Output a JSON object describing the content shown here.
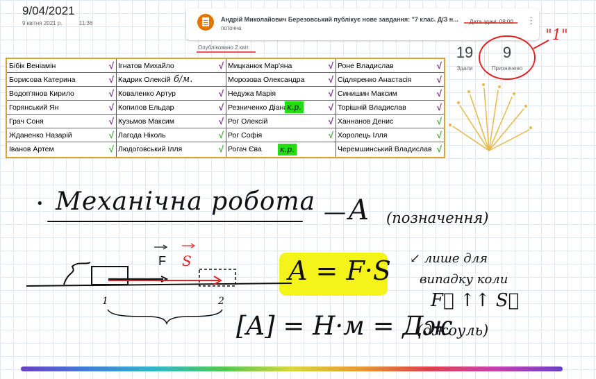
{
  "note": {
    "date": "9/04/2021",
    "subdate": "9 квітня 2021 р.",
    "subtime": "11:36"
  },
  "classroom": {
    "title": "Андрій Миколайович Березовський публікує нове завдання: \"7 клас. Д/З н...",
    "subtitle": "поточна",
    "due": "Дата здачі: 08:00",
    "published": "Опубліковано 2 квіт.",
    "assigned_count": "19",
    "assigned_label": "Здали",
    "done_count": "9",
    "done_label": "Призначено"
  },
  "marks": {
    "one": "\"1\"",
    "bm": "б/м.",
    "kr": "к.р."
  },
  "roster": {
    "col1": [
      "Бібік Веніамін",
      "Борисова Катерина",
      "Водоп'янов Кирило",
      "Горянський Ян",
      "Грач Соня",
      "Жданенко Назарій",
      "Іванов Артем"
    ],
    "col2": [
      "Ігнатов Михайло",
      "Кадрик Олексій",
      "Коваленко Артур",
      "Копилов Ельдар",
      "Кузьмов Максим",
      "Лагода Ніколь",
      "Людоговський Ілля"
    ],
    "col3": [
      "Мицканюк Мар'яна",
      "Морозова Олександра",
      "Недужа Марія",
      "Резниченко Діана",
      "Рог Олексій",
      "Рог Софія",
      "Рогач Єва"
    ],
    "col4": [
      "Роне Владислав",
      "Сідляренко Анастасія",
      "Синишин Максим",
      "Торішній Владислав",
      "Ханнанов Денис",
      "Хоролець Ілля",
      "Черемшинський Владислав"
    ],
    "check_glyph": "√"
  },
  "lesson": {
    "bullet": "•",
    "title": "Механічна робота",
    "dash": "—",
    "symbol": "A",
    "symbol_note": "(позначення)",
    "formula": "A = F·S",
    "formula_note_1": "↙ лише для",
    "formula_note_2": "випадку коли",
    "direction": "F⃗ ↑↑ S⃗",
    "units": "[A] = Н·м = Дж",
    "units_note": "(джоуль)",
    "label_f": "F",
    "label_s": "S",
    "point_1": "1",
    "point_2": "2"
  },
  "colors": {
    "highlight": "#f4f41a",
    "tag": "#22dd11",
    "accent_red": "#e02020",
    "check_purple": "#7a2b8f",
    "check_green": "#3aa832"
  }
}
